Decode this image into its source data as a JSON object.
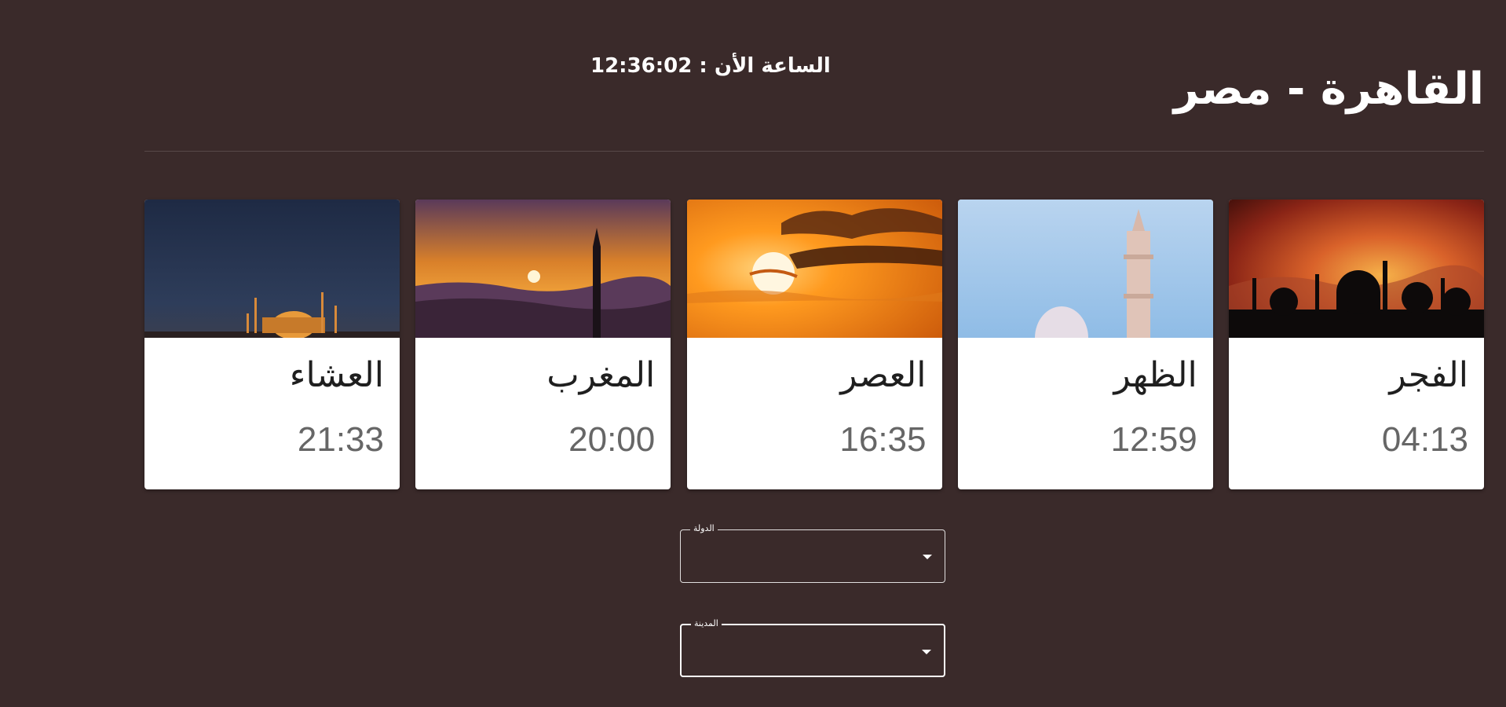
{
  "header": {
    "city_title": "القاهرة - مصر",
    "clock_label": "الساعة الأن :",
    "clock_time": "12:36:02"
  },
  "prayers": [
    {
      "name": "الفجر",
      "time": "04:13",
      "image": "mosque-silhouette-sunset"
    },
    {
      "name": "الظهر",
      "time": "12:59",
      "image": "minaret-blue-sky"
    },
    {
      "name": "العصر",
      "time": "16:35",
      "image": "orange-sun-clouds"
    },
    {
      "name": "المغرب",
      "time": "20:00",
      "image": "sunset-mountains-minaret"
    },
    {
      "name": "العشاء",
      "time": "21:33",
      "image": "mosque-night-lights"
    }
  ],
  "selects": {
    "country": {
      "label": "الدولة",
      "value": ""
    },
    "city": {
      "label": "المدينة",
      "value": ""
    }
  },
  "colors": {
    "background": "#3a2a2a",
    "card": "#ffffff",
    "time_text": "#666666"
  }
}
